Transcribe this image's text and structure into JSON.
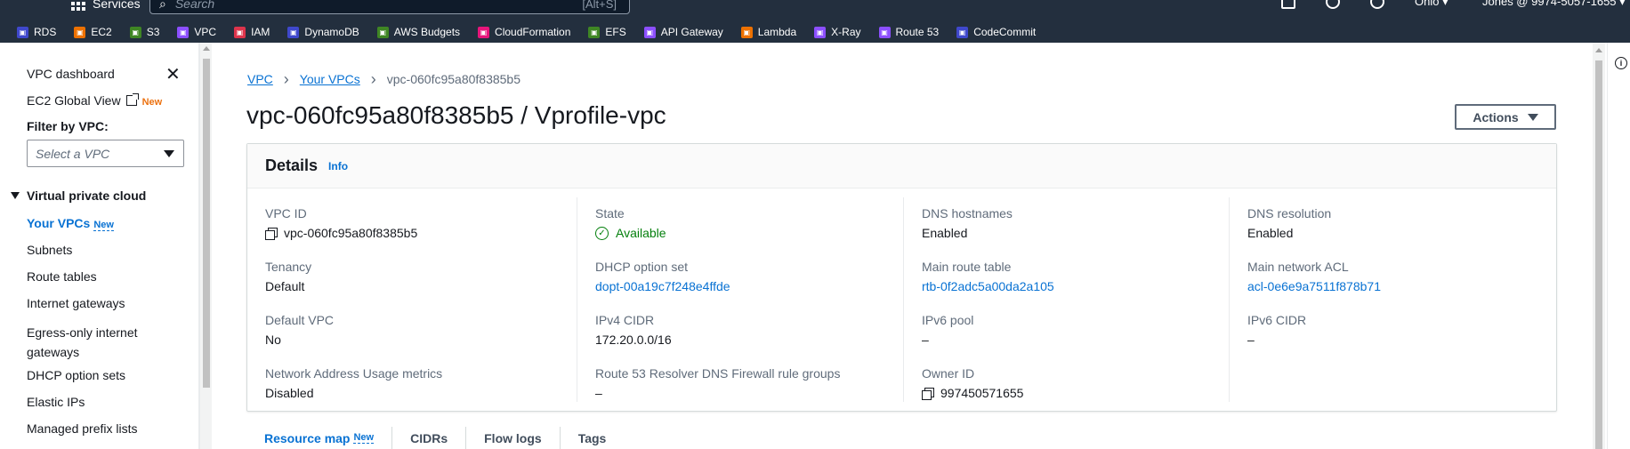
{
  "topnav": {
    "services_label": "Services",
    "search_placeholder": "Search",
    "search_shortcut": "[Alt+S]",
    "region": "Ohio ▾",
    "account": "Jones @ 9974-5057-1655 ▾"
  },
  "favorites": [
    {
      "label": "RDS",
      "color": "#3f48cc",
      "icon": "rds-icon"
    },
    {
      "label": "EC2",
      "color": "#ed7100",
      "icon": "ec2-icon"
    },
    {
      "label": "S3",
      "color": "#3f8624",
      "icon": "s3-icon"
    },
    {
      "label": "VPC",
      "color": "#8c4fff",
      "icon": "vpc-icon"
    },
    {
      "label": "IAM",
      "color": "#dd344c",
      "icon": "iam-icon"
    },
    {
      "label": "DynamoDB",
      "color": "#3f48cc",
      "icon": "dynamodb-icon"
    },
    {
      "label": "AWS Budgets",
      "color": "#3f8624",
      "icon": "budgets-icon"
    },
    {
      "label": "CloudFormation",
      "color": "#e7157b",
      "icon": "cloudformation-icon"
    },
    {
      "label": "EFS",
      "color": "#3f8624",
      "icon": "efs-icon"
    },
    {
      "label": "API Gateway",
      "color": "#8c4fff",
      "icon": "api-gateway-icon"
    },
    {
      "label": "Lambda",
      "color": "#ed7100",
      "icon": "lambda-icon"
    },
    {
      "label": "X-Ray",
      "color": "#8c4fff",
      "icon": "xray-icon"
    },
    {
      "label": "Route 53",
      "color": "#8c4fff",
      "icon": "route53-icon"
    },
    {
      "label": "CodeCommit",
      "color": "#3f48cc",
      "icon": "codecommit-icon"
    }
  ],
  "sidebar": {
    "dashboard": "VPC dashboard",
    "global_view": "EC2 Global View",
    "global_view_badge": "New",
    "filter_label": "Filter by VPC:",
    "filter_placeholder": "Select a VPC",
    "section": "Virtual private cloud",
    "active_item": "Your VPCs",
    "active_badge": "New",
    "items": [
      "Subnets",
      "Route tables",
      "Internet gateways",
      "Egress-only internet gateways",
      "DHCP option sets",
      "Elastic IPs",
      "Managed prefix lists"
    ]
  },
  "breadcrumb": {
    "root": "VPC",
    "parent": "Your VPCs",
    "current": "vpc-060fc95a80f8385b5"
  },
  "page": {
    "title": "vpc-060fc95a80f8385b5 / Vprofile-vpc",
    "actions_label": "Actions"
  },
  "details": {
    "title": "Details",
    "info": "Info",
    "columns": [
      [
        {
          "label": "VPC ID",
          "value": "vpc-060fc95a80f8385b5"
        },
        {
          "label": "Tenancy",
          "value": "Default"
        },
        {
          "label": "Default VPC",
          "value": "No"
        },
        {
          "label": "Network Address Usage metrics",
          "value": "Disabled"
        }
      ],
      [
        {
          "label": "State",
          "value": "Available"
        },
        {
          "label": "DHCP option set",
          "value": "dopt-00a19c7f248e4ffde"
        },
        {
          "label": "IPv4 CIDR",
          "value": "172.20.0.0/16"
        },
        {
          "label": "Route 53 Resolver DNS Firewall rule groups",
          "value": "–"
        }
      ],
      [
        {
          "label": "DNS hostnames",
          "value": "Enabled"
        },
        {
          "label": "Main route table",
          "value": "rtb-0f2adc5a00da2a105"
        },
        {
          "label": "IPv6 pool",
          "value": "–"
        },
        {
          "label": "Owner ID",
          "value": "997450571655"
        }
      ],
      [
        {
          "label": "DNS resolution",
          "value": "Enabled"
        },
        {
          "label": "Main network ACL",
          "value": "acl-0e6e9a7511f878b71"
        },
        {
          "label": "IPv6 CIDR",
          "value": "–"
        }
      ]
    ]
  },
  "tabs": {
    "resource_map": "Resource map",
    "resource_map_badge": "New",
    "cidrs": "CIDRs",
    "flow_logs": "Flow logs",
    "tags": "Tags"
  },
  "colors": {
    "nav_bg": "#232f3e",
    "link": "#0972d3",
    "success": "#037f0c",
    "new_badge": "#ec7211"
  }
}
